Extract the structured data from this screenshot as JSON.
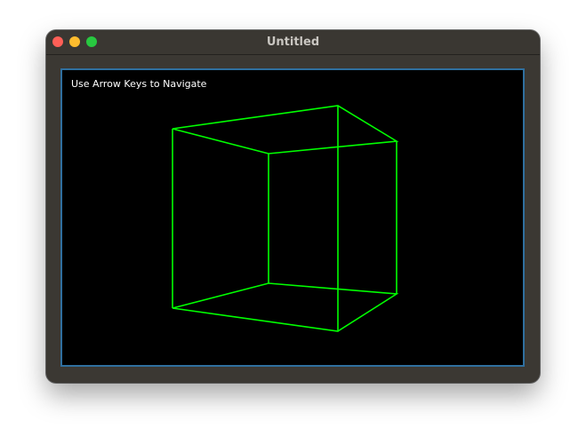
{
  "window": {
    "title": "Untitled"
  },
  "canvas": {
    "hint_text": "Use Arrow Keys to Navigate",
    "border_color": "#2f6f9f",
    "background_color": "#000000",
    "wireframe_color": "#00ff00"
  },
  "icons": {
    "close": "close-traffic-light",
    "minimize": "minimize-traffic-light",
    "zoom": "zoom-traffic-light"
  }
}
